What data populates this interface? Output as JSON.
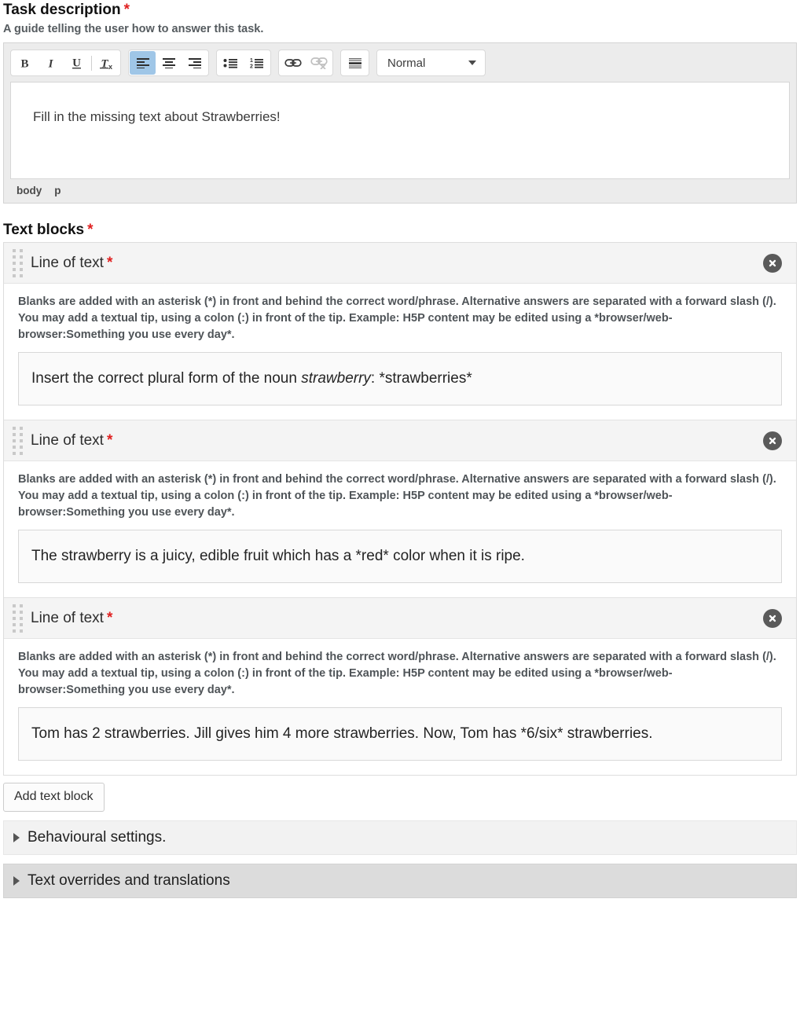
{
  "task_description": {
    "label": "Task description",
    "required_marker": "*",
    "description": "A guide telling the user how to answer this task.",
    "toolbar": {
      "bold_label": "B",
      "italic_label": "I",
      "underline_label": "U",
      "remove_format_label": "Tx",
      "align_left_label": "Align left",
      "align_center_label": "Align center",
      "align_right_label": "Align right",
      "bulleted_list_label": "Insert/Remove Bulleted List",
      "numbered_list_label": "Insert/Remove Numbered List",
      "link_label": "Link",
      "unlink_label": "Unlink",
      "horizontal_rule_label": "Insert Horizontal Line",
      "format_select_value": "Normal"
    },
    "content": "Fill in the missing text about Strawberries!",
    "element_path": [
      "body",
      "p"
    ]
  },
  "text_blocks": {
    "label": "Text blocks",
    "required_marker": "*",
    "help_text": "Blanks are added with an asterisk (*) in front and behind the correct word/phrase. Alternative answers are separated with a forward slash (/). You may add a textual tip, using a colon (:) in front of the tip. Example: H5P content may be edited using a *browser/web-browser:Something you use every day*.",
    "item_title": "Line of text",
    "item_required_marker": "*",
    "remove_icon_label": "Remove",
    "items": [
      {
        "text_html": "Insert the correct plural form of the noun <em>strawberry</em>: *strawberries*",
        "text": "Insert the correct plural form of the noun strawberry: *strawberries*"
      },
      {
        "text_html": "The strawberry is a juicy, edible fruit which has a *red* color when it is ripe.",
        "text": "The strawberry is a juicy, edible fruit which has a *red* color when it is ripe."
      },
      {
        "text_html": "Tom has 2 strawberries. Jill gives him 4 more strawberries. Now, Tom has *6/six* strawberries.",
        "text": "Tom has 2 strawberries. Jill gives him 4 more strawberries. Now, Tom has *6/six* strawberries."
      }
    ],
    "add_button_label": "Add text block"
  },
  "panels": [
    {
      "label": "Behavioural settings.",
      "expanded": false
    },
    {
      "label": "Text overrides and translations",
      "expanded": false
    }
  ],
  "colors": {
    "required_red": "#e02020",
    "active_toolbar_blue": "#9fc6e7",
    "panel_light": "#f2f2f2",
    "panel_dark": "#dcdcdc",
    "block_header": "#f4f4f4"
  }
}
